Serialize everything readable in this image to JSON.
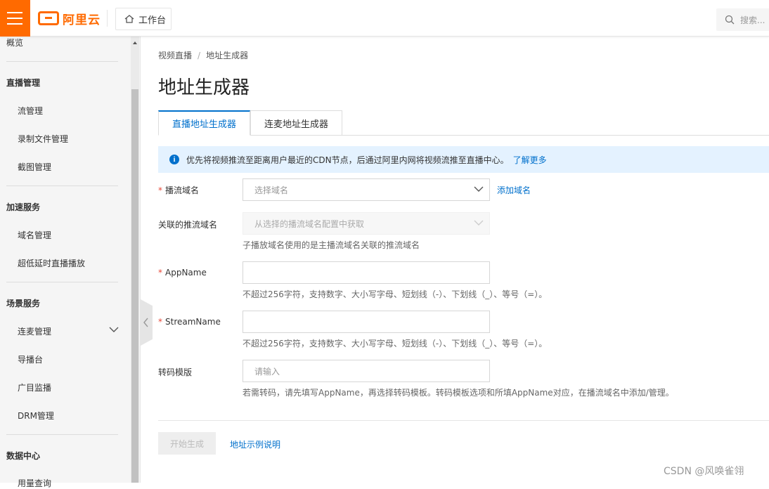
{
  "header": {
    "logo_text": "阿里云",
    "workbench_label": "工作台",
    "search_placeholder": "搜索..."
  },
  "sidebar": {
    "overview": "概览",
    "groups": [
      {
        "title": "直播管理",
        "items": [
          "流管理",
          "录制文件管理",
          "截图管理"
        ]
      },
      {
        "title": "加速服务",
        "items": [
          "域名管理",
          "超低延时直播播放"
        ]
      },
      {
        "title": "场景服务",
        "items": [
          "连麦管理",
          "导播台",
          "广目监播",
          "DRM管理"
        ]
      },
      {
        "title": "数据中心",
        "items": [
          "用量查询"
        ]
      }
    ]
  },
  "breadcrumb": {
    "parent": "视频直播",
    "current": "地址生成器"
  },
  "page_title": "地址生成器",
  "tabs": [
    {
      "label": "直播地址生成器",
      "active": true
    },
    {
      "label": "连麦地址生成器",
      "active": false
    }
  ],
  "notice": {
    "text": "优先将视频推流至距离用户最近的CDN节点，后通过阿里内网将视频流推至直播中心。",
    "link": "了解更多"
  },
  "form": {
    "play_domain": {
      "label": "播流域名",
      "placeholder": "选择域名",
      "action": "添加域名"
    },
    "push_domain": {
      "label": "关联的推流域名",
      "placeholder": "从选择的播流域名配置中获取",
      "hint": "子播放域名使用的是主播流域名关联的推流域名"
    },
    "app_name": {
      "label": "AppName",
      "hint": "不超过256字符，支持数字、大小写字母、短划线（-）、下划线（_）、等号（=）。"
    },
    "stream_name": {
      "label": "StreamName",
      "hint": "不超过256字符，支持数字、大小写字母、短划线（-）、下划线（_）、等号（=）。"
    },
    "transcode": {
      "label": "转码模版",
      "placeholder": "请输入",
      "hint": "若需转码，请先填写AppName，再选择转码模板。转码模板选项和所填AppName对应，在播流域名中添加/管理。"
    }
  },
  "actions": {
    "generate": "开始生成",
    "example": "地址示例说明"
  },
  "credit": "CSDN @风唤雀翎",
  "colors": {
    "brand": "#ff6a00",
    "link": "#0070cc",
    "notice_bg": "#e4f2ff",
    "required": "#e84738"
  }
}
